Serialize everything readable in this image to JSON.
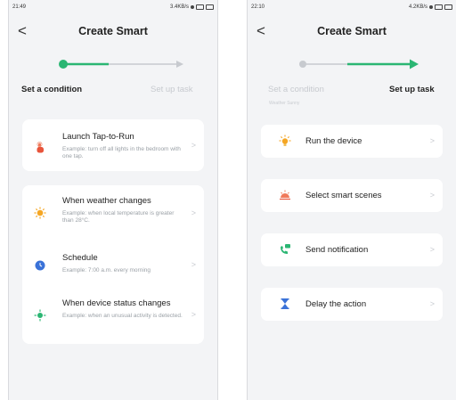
{
  "left": {
    "status": {
      "time": "21:49",
      "right": "3.4KB/s"
    },
    "header": {
      "title": "Create Smart",
      "back": "<"
    },
    "steps": {
      "first": "Set a condition",
      "second": "Set up task"
    },
    "items": [
      {
        "title": "Launch Tap-to-Run",
        "subtitle": "Example: turn off all lights in the bedroom with one tap.",
        "icon": "hand-tap-icon"
      },
      {
        "title": "When weather changes",
        "subtitle": "Example: when local temperature is greater than 28°C.",
        "icon": "sun-icon"
      },
      {
        "title": "Schedule",
        "subtitle": "Example: 7:00 a.m. every morning",
        "icon": "clock-icon"
      },
      {
        "title": "When device status changes",
        "subtitle": "Example: when an unusual activity is detected.",
        "icon": "device-icon"
      }
    ]
  },
  "right": {
    "status": {
      "time": "22:10",
      "right": "4.2KB/s"
    },
    "header": {
      "title": "Create Smart",
      "back": "<"
    },
    "steps": {
      "first": "Set a condition",
      "second": "Set up task",
      "hint": "Weather Sunny"
    },
    "tasks": [
      {
        "title": "Run the device",
        "icon": "device-run-icon"
      },
      {
        "title": "Select smart scenes",
        "icon": "scene-icon"
      },
      {
        "title": "Send notification",
        "icon": "notification-icon"
      },
      {
        "title": "Delay the action",
        "icon": "hourglass-icon"
      }
    ]
  },
  "colors": {
    "accent": "#2bb673",
    "inactive": "#c7cacf",
    "card": "#ffffff",
    "background": "#f3f4f6"
  }
}
